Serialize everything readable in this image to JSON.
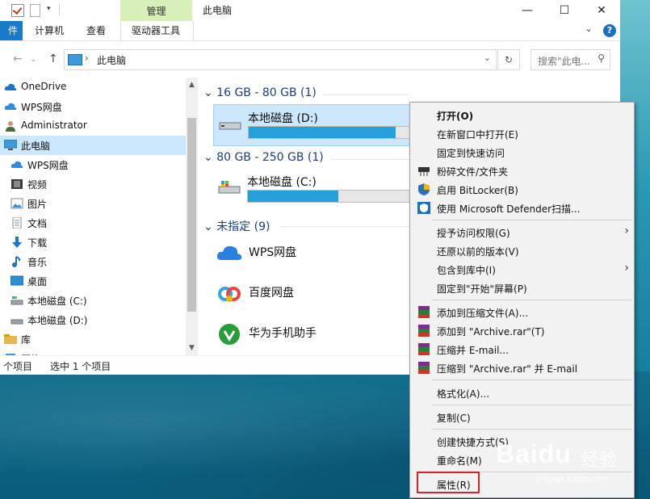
{
  "window": {
    "title": "此电脑",
    "manage_tab": "管理",
    "controls": {
      "minimize": "—",
      "maximize": "☐",
      "close": "✕"
    }
  },
  "ribbon": {
    "file": "件",
    "tabs": [
      "计算机",
      "查看",
      "驱动器工具"
    ],
    "help": "?"
  },
  "address": {
    "path": "此电脑",
    "search_placeholder": "搜索\"此电...",
    "back": "←",
    "forward": "→",
    "up": "↑"
  },
  "sidebar": {
    "items": [
      {
        "label": "OneDrive",
        "icon": "cloud-icon"
      },
      {
        "label": "WPS网盘",
        "icon": "cloud-icon"
      },
      {
        "label": "Administrator",
        "icon": "user-icon"
      },
      {
        "label": "此电脑",
        "icon": "computer-icon"
      },
      {
        "label": "WPS网盘",
        "icon": "cloud-icon"
      },
      {
        "label": "视频",
        "icon": "video-icon"
      },
      {
        "label": "图片",
        "icon": "picture-icon"
      },
      {
        "label": "文档",
        "icon": "document-icon"
      },
      {
        "label": "下载",
        "icon": "download-icon"
      },
      {
        "label": "音乐",
        "icon": "music-icon"
      },
      {
        "label": "桌面",
        "icon": "desktop-icon"
      },
      {
        "label": "本地磁盘 (C:)",
        "icon": "drive-icon"
      },
      {
        "label": "本地磁盘 (D:)",
        "icon": "drive-icon"
      },
      {
        "label": "库",
        "icon": "library-icon"
      },
      {
        "label": "网络",
        "icon": "network-icon"
      }
    ]
  },
  "content": {
    "groups": [
      {
        "header": "16 GB - 80 GB (1)"
      },
      {
        "header": "80 GB - 250 GB (1)"
      },
      {
        "header": "未指定 (9)"
      }
    ],
    "drives": [
      {
        "name": "本地磁盘 (D:)",
        "used_fraction": 0.86
      },
      {
        "name": "本地磁盘 (C:)",
        "used_fraction": 0.53
      }
    ],
    "apps": [
      {
        "name": "WPS网盘",
        "icon": "wps-cloud-icon"
      },
      {
        "name": "百度网盘",
        "icon": "baidu-netdisk-icon"
      },
      {
        "name": "华为手机助手",
        "icon": "huawei-assistant-icon"
      }
    ]
  },
  "status": {
    "count": "个项目",
    "selected": "选中 1 个项目"
  },
  "context_menu": {
    "open": "打开(O)",
    "open_new_window": "在新窗口中打开(E)",
    "pin_quick_access": "固定到快速访问",
    "shred": "粉碎文件/文件夹",
    "bitlocker": "启用 BitLocker(B)",
    "defender": "使用 Microsoft Defender扫描...",
    "give_access": "授予访问权限(G)",
    "restore_previous": "还原以前的版本(V)",
    "include_library": "包含到库中(I)",
    "pin_start": "固定到\"开始\"屏幕(P)",
    "add_archive": "添加到压缩文件(A)...",
    "add_archive_rar": "添加到 \"Archive.rar\"(T)",
    "compress_email": "压缩并 E-mail...",
    "compress_rar_email": "压缩到 \"Archive.rar\" 并 E-mail",
    "format": "格式化(A)...",
    "copy": "复制(C)",
    "create_shortcut": "创建快捷方式(S)",
    "rename": "重命名(M)",
    "properties": "属性(R)"
  },
  "watermark": {
    "brand": "Baidu",
    "jingyan": "经验",
    "url": "jingyan.baidu.com"
  },
  "colors": {
    "accent": "#1979ca",
    "selection": "#cce8ff",
    "manage": "#d7f0b7",
    "progress": "#26a0da",
    "highlight_box": "#d3242e"
  }
}
